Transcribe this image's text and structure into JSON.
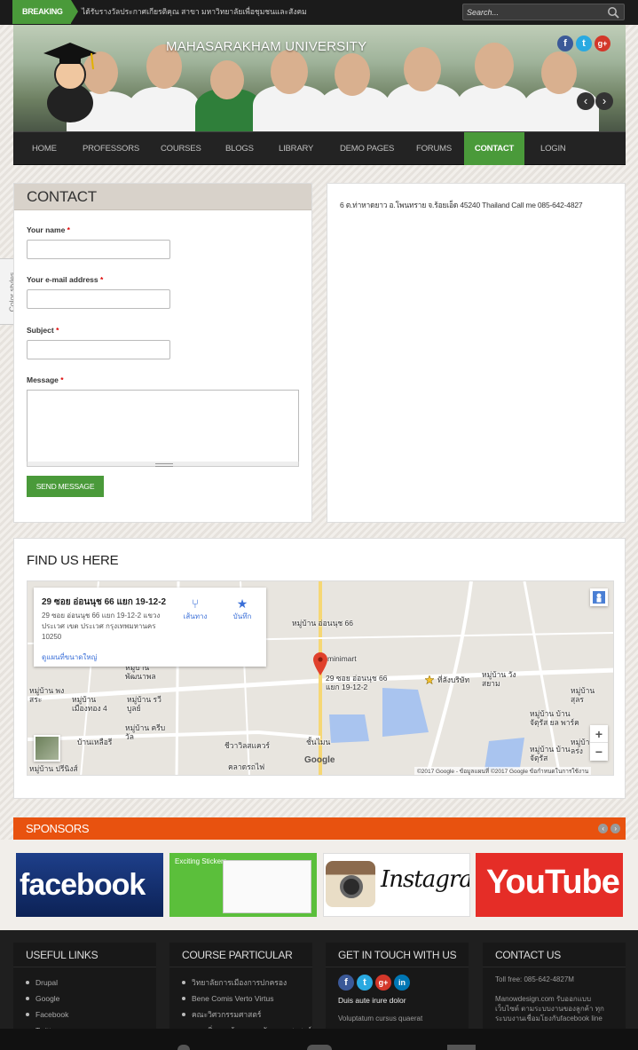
{
  "topbar": {
    "breaking_label": "BREAKING",
    "ticker_text": "ได้รับรางวัลประกาศเกียรติคุณ สาขา มหาวิทยาลัยเพื่อชุมชนและสังคม",
    "search_placeholder": "Search..."
  },
  "banner": {
    "site_title": "MAHASARAKHAM UNIVERSITY",
    "social": [
      "f",
      "t",
      "g+"
    ],
    "prev_label": "‹",
    "next_label": "›"
  },
  "nav": {
    "items": [
      "HOME",
      "PROFESSORS",
      "COURSES",
      "BLOGS",
      "LIBRARY",
      "DEMO PAGES",
      "FORUMS",
      "CONTACT",
      "LOGIN"
    ],
    "active": "CONTACT"
  },
  "color_styles_tab": "Color styles",
  "contact": {
    "title": "CONTACT",
    "name_label": "Your name",
    "email_label": "Your e-mail address",
    "subject_label": "Subject",
    "message_label": "Message",
    "required_mark": "*",
    "send_label": "SEND MESSAGE"
  },
  "address_text": "6 ต.ท่าหาดยาว อ.โพนทราย จ.ร้อยเอ็ด 45240 Thailand Call me 085-642-4827",
  "find_us": {
    "title": "FIND US HERE",
    "card_title": "29 ซอย อ่อนนุช 66 แยก 19-12-2",
    "card_address": "29 ซอย อ่อนนุช 66 แยก 19-12-2 แขวง ประเวศ เขต ประเวศ กรุงเทพมหานคร 10250",
    "card_link": "ดูแผนที่ขนาดใหญ่",
    "directions_label": "เส้นทาง",
    "save_label": "บันทึก",
    "labels": [
      "หมู่บ้าน อ่อนนุช 66",
      "minimart",
      "29 ซอย อ่อนนุช 66 แยก 19-12-2",
      "ที่ลังบริษัท",
      "หมู่บ้าน วังสยาม",
      "หมู่บ้าน พัฒนาพล",
      "หมู่บ้าน เมืองทอง 4",
      "หมู่บ้าน รวีบูลย์",
      "หมู่บ้าน ครีบวัล",
      "บ้านเหลือรี",
      "ชีวาวิลสแควร์",
      "คลาดรถไฟ",
      "หมู่บ้าน บ้านจัตุรัส ยล พาร์ค",
      "หมู่บ้าน บ้านจัตุรัส",
      "หมู่บ้าน พงสระ",
      "หมู่บ้าน ปรีนิงส์",
      "ชั้นไมน",
      "หมู่บ้าน สุลร",
      "หมู่บ้าน สุลร่ง"
    ],
    "footer_text": "©2017 Google - ข้อมูลแผนที่ ©2017 Google   ข้อกำหนดในการใช้งาน",
    "google_text": "Google",
    "zoom_in": "+",
    "zoom_out": "−"
  },
  "sponsors": {
    "title": "SPONSORS",
    "facebook_text": "facebook",
    "line_text": "Exciting Stickers",
    "instagram_text": "Instagram",
    "youtube_text": "YouTube"
  },
  "footer": {
    "useful_links": {
      "title": "USEFUL LINKS",
      "items": [
        "Drupal",
        "Google",
        "Facebook",
        "Twitter"
      ]
    },
    "course_particular": {
      "title": "COURSE PARTICULAR",
      "items": [
        "วิทยาลัยการเมืองการปกครอง",
        "Bene Comis Verto Virtus",
        "คณะวิศวกรรมศาสตร์",
        "คณะสิ่งแวดล้อมและทรัพยากรศาสตร์"
      ]
    },
    "get_in_touch": {
      "title": "GET IN TOUCH WITH US",
      "bold_text": "Duis aute irure dolor",
      "body_text": "Voluptatum cursus quaerat"
    },
    "contact_us": {
      "title": "CONTACT US",
      "tollfree": "Toll free: 085-642-4827M",
      "body_text": "Manowdesign.com รับออกแบบเว็บไซต์ ตามระบบงานของลูกค้า ทุกระบบงานเชื่อมโยงกับfacebook line"
    }
  },
  "colors": {
    "accent_green": "#4a9a3a",
    "sponsor_orange": "#e8520f",
    "footer_dark": "#1f1f1f"
  }
}
